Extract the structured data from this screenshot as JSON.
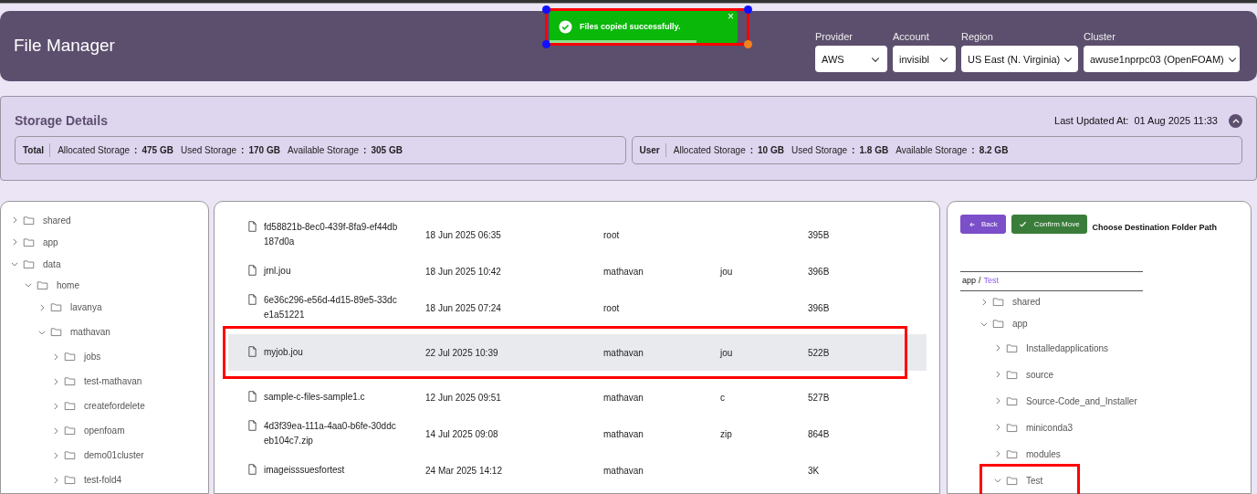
{
  "header": {
    "title": "File Manager"
  },
  "toast": {
    "message": "Files copied successfully.",
    "close": "×",
    "level": 0.78,
    "highlighted": true
  },
  "filters": [
    {
      "label": "Provider",
      "value": "AWS"
    },
    {
      "label": "Account",
      "value": "invisibl"
    },
    {
      "label": "Region",
      "value": "US East (N. Virginia)"
    },
    {
      "label": "Cluster",
      "value": "awuse1nprpc03 (OpenFOAM)"
    }
  ],
  "storage": {
    "title": "Storage Details",
    "last_updated_label": "Last Updated At:",
    "last_updated": "01 Aug 2025 11:33",
    "expanded": true,
    "groups": [
      {
        "name": "Total",
        "stats": [
          {
            "label": "Allocated Storage",
            "separator": ":",
            "value": "475 GB"
          },
          {
            "label": "Used Storage",
            "separator": ":",
            "value": "170 GB"
          },
          {
            "label": "Available Storage",
            "separator": ":",
            "value": "305 GB"
          }
        ]
      },
      {
        "name": "User",
        "stats": [
          {
            "label": "Allocated Storage",
            "separator": ":",
            "value": "10 GB"
          },
          {
            "label": "Used Storage",
            "separator": ":",
            "value": "1.8 GB"
          },
          {
            "label": "Available Storage",
            "separator": ":",
            "value": "8.2 GB"
          }
        ]
      }
    ]
  },
  "folder_tree": [
    {
      "name": "shared",
      "expanded": false
    },
    {
      "name": "app",
      "expanded": false
    },
    {
      "name": "data",
      "expanded": true,
      "children": [
        {
          "name": "home",
          "expanded": true,
          "children": [
            {
              "name": "lavanya",
              "expanded": false
            },
            {
              "name": "mathavan",
              "expanded": true,
              "children": [
                {
                  "name": "jobs",
                  "expanded": false
                },
                {
                  "name": "test-mathavan",
                  "expanded": false
                },
                {
                  "name": "createfordelete",
                  "expanded": false
                },
                {
                  "name": "openfoam",
                  "expanded": false
                },
                {
                  "name": "demo01cluster",
                  "expanded": false
                },
                {
                  "name": "test-fold4",
                  "expanded": false
                }
              ]
            }
          ]
        }
      ]
    }
  ],
  "files": [
    {
      "name": "fd58821b-8ec0-439f-8fa9-ef44db187d0a",
      "modified": "18 Jun 2025 06:35",
      "owner": "root",
      "size": "395B",
      "selected": false
    },
    {
      "name": "jrnl.jou",
      "modified": "18 Jun 2025 10:42",
      "owner": "mathavan",
      "type": "jou",
      "size": "396B",
      "selected": false
    },
    {
      "name": "6e36c296-e56d-4d15-89e5-33dce1a51221",
      "modified": "18 Jun 2025 07:24",
      "owner": "root",
      "size": "396B",
      "selected": false
    },
    {
      "name": "myjob.jou",
      "modified": "22 Jul 2025 10:39",
      "owner": "mathavan",
      "type": "jou",
      "size": "522B",
      "selected": true
    },
    {
      "name": "sample-c-files-sample1.c",
      "modified": "12 Jun 2025 09:51",
      "owner": "mathavan",
      "type": "c",
      "size": "527B",
      "selected": false
    },
    {
      "name": "4d3f39ea-111a-4aa0-b6fe-30ddceb104c7.zip",
      "modified": "14 Jul 2025 09:08",
      "owner": "mathavan",
      "type": "zip",
      "size": "864B",
      "selected": false
    },
    {
      "name": "imageisssuesfortest",
      "modified": "24 Mar 2025 14:12",
      "owner": "mathavan",
      "size": "3K",
      "selected": false
    }
  ],
  "move_panel": {
    "back": "Back",
    "confirm": "Confirm Move",
    "title": "Choose Destination Folder Path",
    "path": [
      {
        "name": "app",
        "current": false
      },
      {
        "name": "Test",
        "current": true
      }
    ],
    "separator": "/",
    "tree": [
      {
        "name": "shared",
        "expanded": false
      },
      {
        "name": "app",
        "expanded": true,
        "children": [
          {
            "name": "Installedapplications",
            "expanded": false
          },
          {
            "name": "source",
            "expanded": false
          },
          {
            "name": "Source-Code_and_Installer",
            "expanded": false
          },
          {
            "name": "miniconda3",
            "expanded": false
          },
          {
            "name": "modules",
            "expanded": false
          },
          {
            "name": "Test",
            "expanded": true,
            "selected": true
          }
        ]
      }
    ]
  }
}
